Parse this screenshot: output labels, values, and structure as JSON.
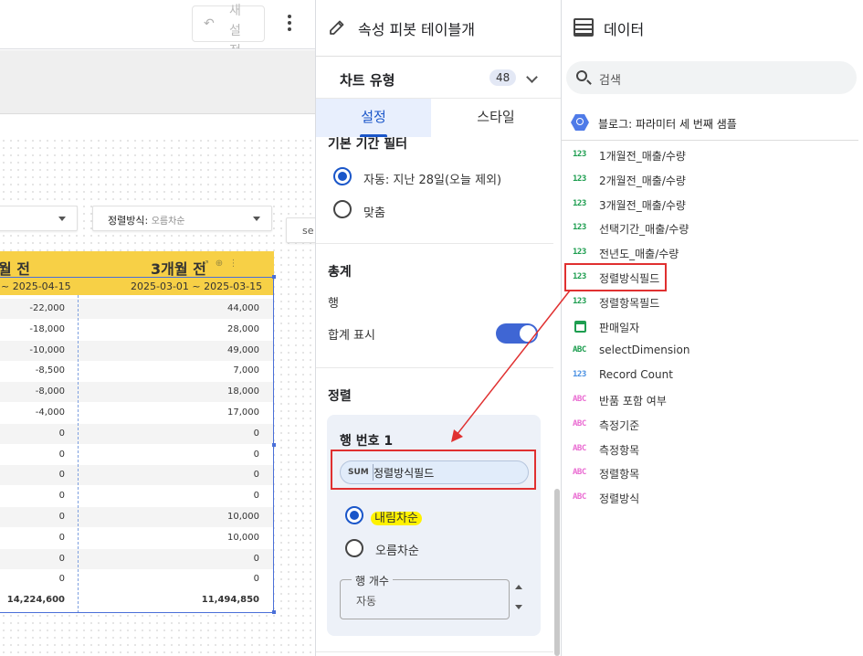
{
  "toolbar": {
    "reset_label": "새 설 정"
  },
  "filters": {
    "sort_control_label": "정렬방식",
    "sort_control_value": "오름차순",
    "partial_button": "se"
  },
  "table": {
    "headers": [
      "월 전",
      "3개월 전"
    ],
    "date_ranges": [
      "~  2025-04-15",
      "2025-03-01  ~  2025-03-15"
    ],
    "rows": [
      [
        "-22,000",
        "44,000"
      ],
      [
        "-18,000",
        "28,000"
      ],
      [
        "-10,000",
        "49,000"
      ],
      [
        "-8,500",
        "7,000"
      ],
      [
        "-8,000",
        "18,000"
      ],
      [
        "-4,000",
        "17,000"
      ],
      [
        "0",
        "0"
      ],
      [
        "0",
        "0"
      ],
      [
        "0",
        "0"
      ],
      [
        "0",
        "0"
      ],
      [
        "0",
        "10,000"
      ],
      [
        "0",
        "10,000"
      ],
      [
        "0",
        "0"
      ],
      [
        "0",
        "0"
      ]
    ],
    "totals": [
      "14,224,600",
      "11,494,850"
    ]
  },
  "props": {
    "title": "속성 피봇 테이블개",
    "chart_type_label": "차트 유형",
    "chart_type_count": "48",
    "tabs": [
      "설정",
      "스타일"
    ],
    "date_range_title": "기본 기간 필터",
    "date_options": [
      "자동: 지난 28일(오늘 제외)",
      "맞춤"
    ],
    "totals_title": "총계",
    "totals_row_label": "행",
    "show_totals_label": "합계 표시",
    "sort_title": "정렬",
    "sort_card_title": "행 번호 1",
    "sort_agg": "SUM",
    "sort_field": "정렬방식필드",
    "sort_options": [
      "내림차순",
      "오름차순"
    ],
    "row_count_label": "행 개수",
    "row_count_value": "자동"
  },
  "data_panel": {
    "title": "데이터",
    "search_placeholder": "검색",
    "source_name": "블로그: 파라미터 세 번째 샘플",
    "fields": [
      {
        "type": "123",
        "label": "1개월전_매출/수량"
      },
      {
        "type": "123",
        "label": "2개월전_매출/수량"
      },
      {
        "type": "123",
        "label": "3개월전_매출/수량"
      },
      {
        "type": "123",
        "label": "선택기간_매출/수량"
      },
      {
        "type": "123",
        "label": "전년도_매출/수량"
      },
      {
        "type": "123",
        "label": "정렬방식필드"
      },
      {
        "type": "123",
        "label": "정렬항목필드"
      },
      {
        "type": "date",
        "label": "판매일자"
      },
      {
        "type": "ABC",
        "label": "selectDimension"
      },
      {
        "type": "123",
        "label": "Record Count"
      },
      {
        "type": "ABC",
        "label": "반품 포함 여부"
      },
      {
        "type": "ABC",
        "label": "측정기준"
      },
      {
        "type": "ABC",
        "label": "측정항목"
      },
      {
        "type": "ABC",
        "label": "정렬항목"
      },
      {
        "type": "ABC",
        "label": "정렬방식"
      }
    ]
  },
  "colors": {
    "accent": "#1a56c9",
    "highlight": "#fff200",
    "annotation": "#e03030",
    "table_header": "#f7d046"
  }
}
